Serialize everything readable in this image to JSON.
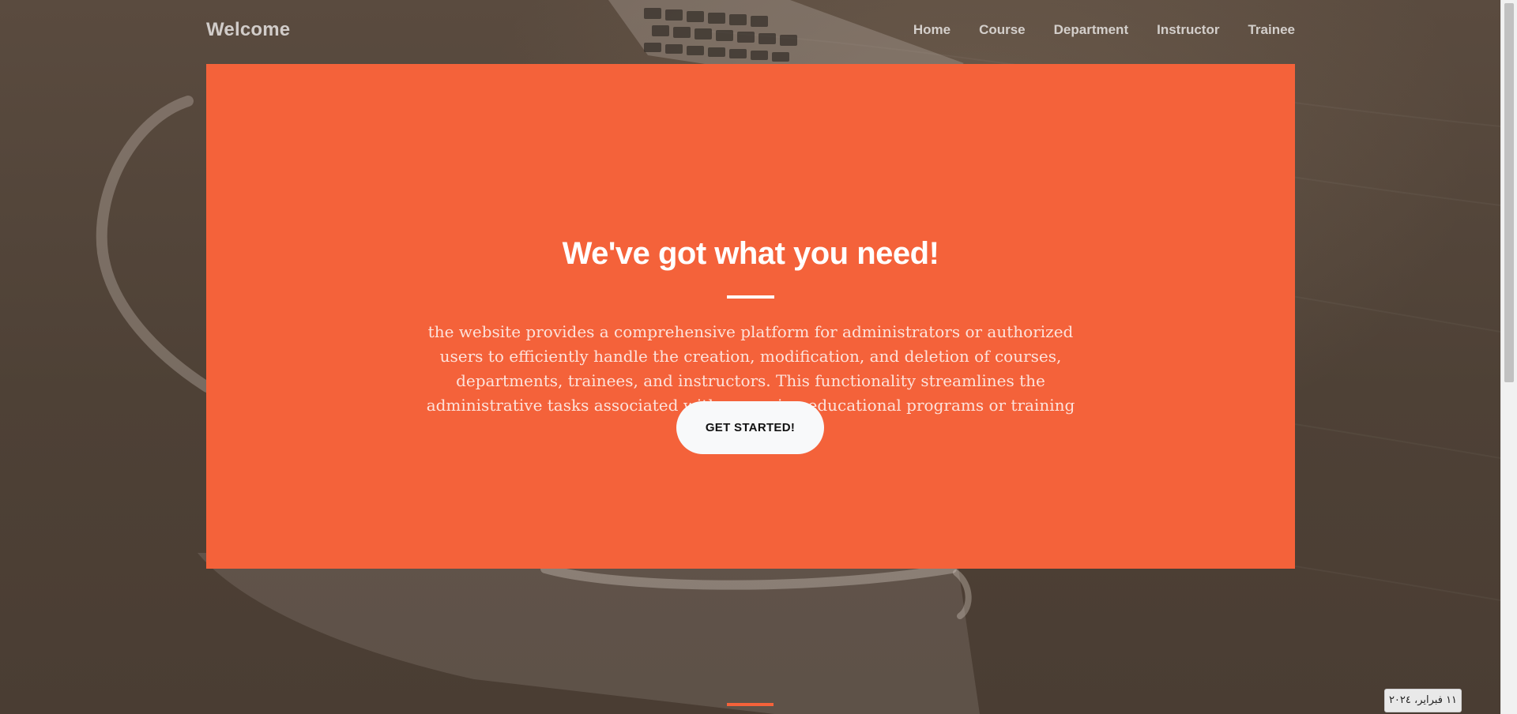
{
  "navbar": {
    "brand": "Welcome",
    "links": [
      "Home",
      "Course",
      "Department",
      "Instructor",
      "Trainee"
    ]
  },
  "hero": {
    "heading": "We've got what you need!",
    "description": "the website provides a comprehensive platform for administrators or authorized users to efficiently handle the creation, modification, and deletion of courses, departments, trainees, and instructors. This functionality streamlines the administrative tasks associated with managing educational programs or training initiatives.",
    "cta_label": "GET STARTED!"
  },
  "date_tooltip": "١١ فبراير، ٢٠٢٤",
  "colors": {
    "accent": "#f4623a",
    "background": "#4e4136",
    "button": "#f8f9fa"
  },
  "icons": {
    "background_image": "laptop-and-coffee-cup-photo"
  }
}
